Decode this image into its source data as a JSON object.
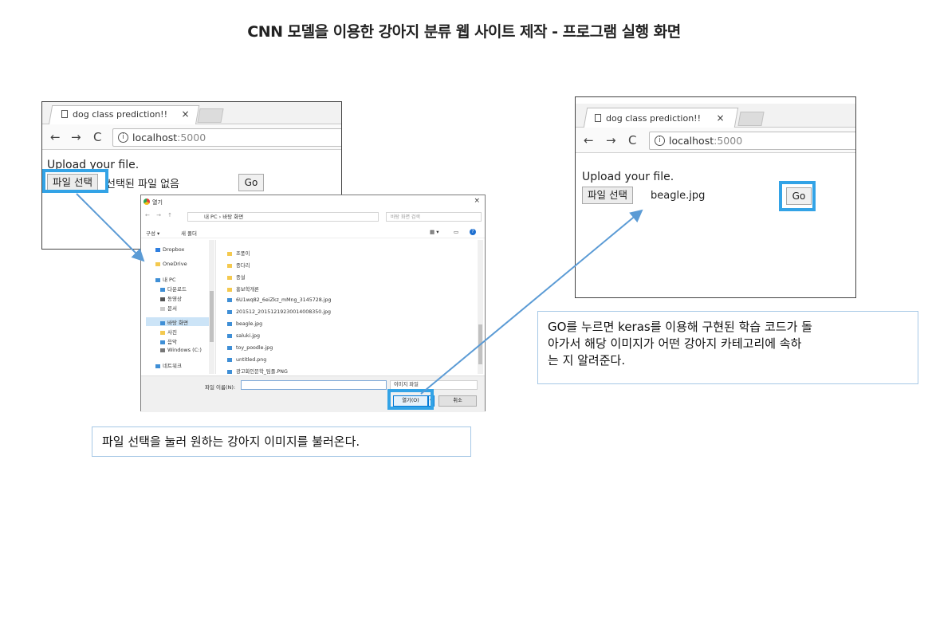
{
  "slide_title": "CNN 모델을 이용한 강아지 분류 웹 사이트 제작 - 프로그램 실행 화면",
  "left_browser": {
    "tab_title": "dog class prediction!!",
    "tab_close": "×",
    "back": "←",
    "forward": "→",
    "reload": "C",
    "info_glyph": "i",
    "url_host": "localhost",
    "url_port": ":5000",
    "upload_label": "Upload your file.",
    "choose_button": "파일 선택",
    "file_status": "선택된 파일 없음",
    "go_button": "Go"
  },
  "dialog": {
    "title": "열기",
    "close": "×",
    "path": "내 PC › 바탕 화면",
    "search_placeholder": "바탕 화면 검색",
    "organize": "구성 ▾",
    "new_folder": "새 폴더",
    "nav_items": [
      "Dropbox",
      "OneDrive",
      "내 PC",
      "다운로드",
      "동영상",
      "문서",
      "바탕 화면",
      "사진",
      "음악",
      "Windows (C:)",
      "네트워크"
    ],
    "files": [
      {
        "name": "조풍이",
        "kind": "folder"
      },
      {
        "name": "종다리",
        "kind": "folder"
      },
      {
        "name": "종설",
        "kind": "folder"
      },
      {
        "name": "홍보학개론",
        "kind": "folder"
      },
      {
        "name": "6U1wq82_6eiZkz_mMng_3145728.jpg",
        "kind": "image"
      },
      {
        "name": "201512_20151219230014008350.jpg",
        "kind": "image"
      },
      {
        "name": "beagle.jpg",
        "kind": "image"
      },
      {
        "name": "saluki.jpg",
        "kind": "image"
      },
      {
        "name": "toy_poodle.jpg",
        "kind": "image"
      },
      {
        "name": "untitled.png",
        "kind": "image"
      },
      {
        "name": "광고화인문학_팀플.PNG",
        "kind": "image"
      }
    ],
    "filename_label": "파일 이름(N):",
    "filetype": "이미지 파일",
    "open_button": "열기(O)",
    "cancel_button": "취소"
  },
  "right_browser": {
    "tab_title": "dog class prediction!!",
    "tab_close": "×",
    "back": "←",
    "forward": "→",
    "reload": "C",
    "info_glyph": "i",
    "url_host": "localhost",
    "url_port": ":5000",
    "upload_label": "Upload your file.",
    "choose_button": "파일 선택",
    "file_status": "beagle.jpg",
    "go_button": "Go"
  },
  "callouts": {
    "left": "파일 선택을 눌러 원하는 강아지 이미지를 불러온다.",
    "right_line1": "GO를 누르면 keras를 이용해 구현된 학습 코드가 돌",
    "right_line2": "아가서 해당 이미지가 어떤 강아지 카테고리에 속하",
    "right_line3": "는 지 알려준다."
  },
  "colors": {
    "highlight": "#33a3e6",
    "arrow": "#5b9bd5",
    "callout_border": "#a6c8e6"
  }
}
